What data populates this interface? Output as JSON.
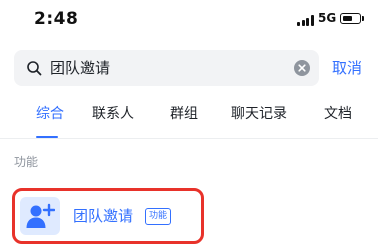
{
  "status_bar": {
    "time": "2:48",
    "network": "5G",
    "battery_level": 0.6
  },
  "search": {
    "value": "团队邀请",
    "cancel_label": "取消"
  },
  "tabs": [
    {
      "label": "综合",
      "active": true
    },
    {
      "label": "联系人",
      "active": false
    },
    {
      "label": "群组",
      "active": false
    },
    {
      "label": "聊天记录",
      "active": false
    },
    {
      "label": "文档",
      "active": false
    }
  ],
  "section": {
    "title": "功能"
  },
  "result": {
    "label": "团队邀请",
    "badge": "功能",
    "icon": "add-user-icon"
  },
  "colors": {
    "accent": "#3370ff",
    "highlight_border": "#e8322a",
    "icon_bg": "#dfeaff"
  }
}
